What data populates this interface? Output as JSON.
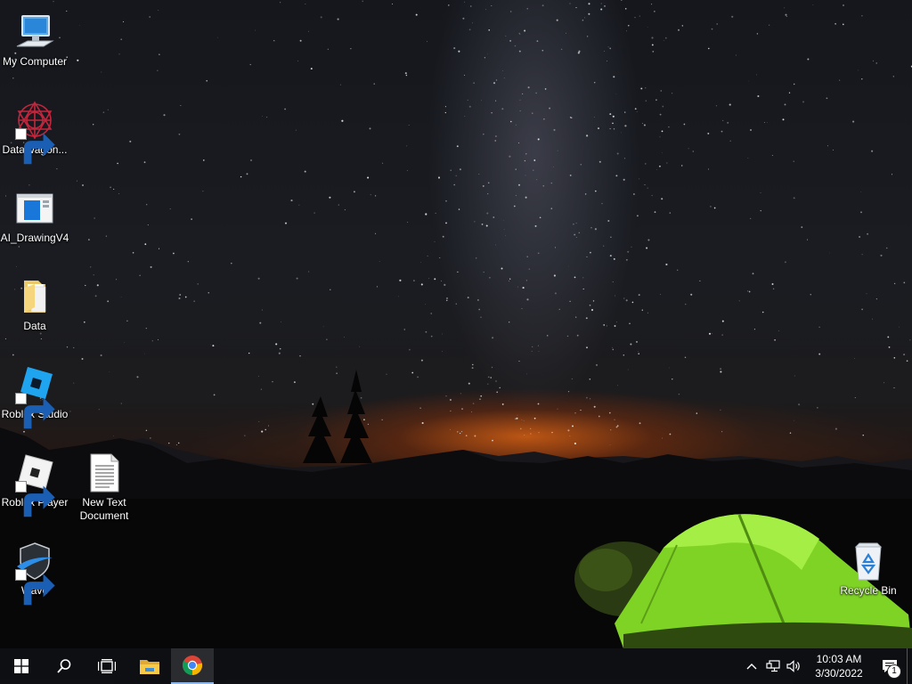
{
  "desktop": {
    "icons": [
      {
        "label": "My Computer",
        "icon": "my-computer-icon",
        "shortcut": false
      },
      {
        "label": "DataWagon...",
        "icon": "datawagon-icon",
        "shortcut": true
      },
      {
        "label": "AI_DrawingV4",
        "icon": "app-window-icon",
        "shortcut": false
      },
      {
        "label": "Data",
        "icon": "folder-icon",
        "shortcut": false
      },
      {
        "label": "Roblox Studio",
        "icon": "roblox-studio-icon",
        "shortcut": true
      },
      {
        "label": "Roblox Player",
        "icon": "roblox-player-icon",
        "shortcut": true
      },
      {
        "label": "New Text Document",
        "icon": "text-document-icon",
        "shortcut": false
      },
      {
        "label": "Wave",
        "icon": "wave-icon",
        "shortcut": true
      },
      {
        "label": "Recycle Bin",
        "icon": "recycle-bin-icon",
        "shortcut": false
      }
    ]
  },
  "taskbar": {
    "pinned": [
      "start-icon",
      "search-icon",
      "task-view-icon",
      "file-explorer-icon",
      "chrome-icon"
    ],
    "active_app": "chrome-icon",
    "tray": {
      "icons": [
        "chevron-up-icon",
        "network-icon",
        "volume-icon"
      ],
      "time": "10:03 AM",
      "date": "3/30/2022",
      "notification_count": "1"
    }
  },
  "colors": {
    "taskbar_bg": "#0e1014",
    "horizon_glow": "#d25f14",
    "tent_green": "#8ee22a"
  }
}
